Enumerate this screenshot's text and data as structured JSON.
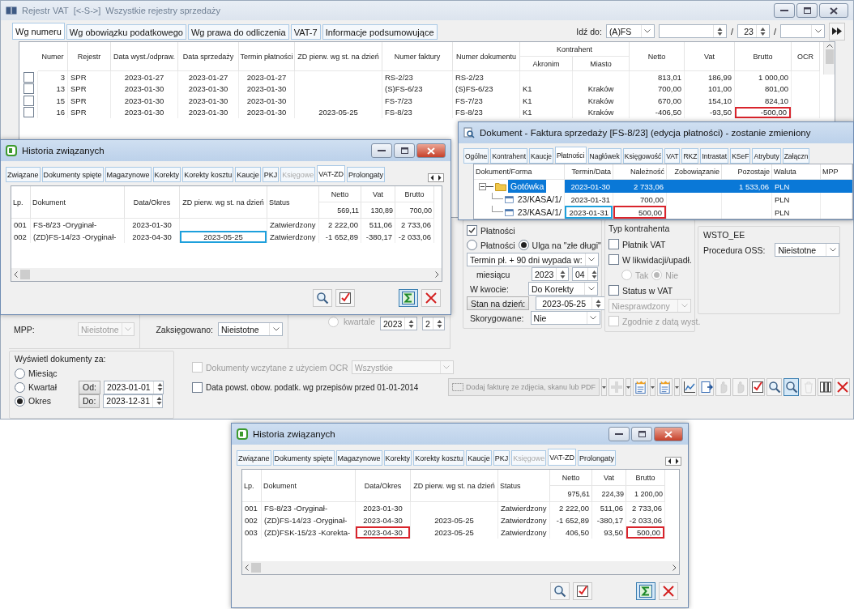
{
  "main_window": {
    "title": "Rejestr VAT",
    "title_tag": "[<-S->]",
    "subtitle": "Wszystkie rejestry sprzedaży",
    "tabs": [
      {
        "label": "Wg numeru",
        "selected": true
      },
      {
        "label": "Wg obowiązku podatkowego",
        "selected": false
      },
      {
        "label": "Wg prawa do odliczenia",
        "selected": false
      },
      {
        "label": "VAT-7",
        "selected": false
      },
      {
        "label": "Informacje podsumowujące",
        "selected": false
      }
    ],
    "goto": {
      "label": "Idź do:",
      "series": "(A)FS",
      "separators": [
        "/",
        "/"
      ],
      "year": "23"
    },
    "table": {
      "columns": [
        "Numer",
        "Rejestr",
        "Data wyst./odpraw.",
        "Data sprzedaży",
        "Termin płatności",
        "ZD pierw. wg st. na dzień",
        "Numer faktury",
        "Numer dokumentu",
        {
          "label": "Akronim",
          "group": "Kontrahent"
        },
        {
          "label": "Miasto",
          "in_group": true
        },
        "Netto",
        "Vat",
        "Brutto",
        "OCR"
      ],
      "rows": [
        {
          "checked": false,
          "cells": [
            "3",
            "SPR",
            "2023-01-27",
            "2023-01-27",
            "2023-01-27",
            null,
            "RS-2/23",
            "RS-2/23",
            null,
            null,
            "813,01",
            "186,99",
            "1 000,00",
            null
          ]
        },
        {
          "checked": false,
          "cells": [
            "13",
            "SPR",
            "2023-01-30",
            "2023-01-30",
            "2023-01-30",
            null,
            "(S)FS-6/23",
            "(S)FS-6/23",
            "K1",
            "Kraków",
            "700,00",
            "101,00",
            "801,00",
            null
          ]
        },
        {
          "checked": false,
          "cells": [
            "15",
            "SPR",
            "2023-01-30",
            "2023-01-30",
            "2023-01-30",
            null,
            "FS-7/23",
            "FS-7/23",
            "K1",
            "Kraków",
            "670,00",
            "154,10",
            "824,10",
            null
          ]
        },
        {
          "checked": false,
          "cells": [
            "16",
            "SPR",
            "2023-01-30",
            "2023-01-30",
            "2023-01-30",
            "2023-05-25",
            "FS-8/23",
            "FS-8/23",
            "K1",
            "Kraków",
            "-406,50",
            "-93,50",
            {
              "text": "-500,00",
              "marked": true
            },
            null
          ]
        }
      ]
    },
    "filters": {
      "mpp": {
        "label": "MPP:",
        "value": "Nieistotne",
        "disabled": true
      },
      "booked": {
        "label": "Zaksięgowano:",
        "value": "Nieistotne",
        "disabled": false
      },
      "quarter": {
        "label": "kwartale",
        "selected": false,
        "year": "2023",
        "quarter": "2"
      }
    },
    "period": {
      "title": "Wyświetl dokumenty za:",
      "options": [
        {
          "label": "Miesiąc",
          "selected": false
        },
        {
          "label": "Kwartał",
          "selected": false
        },
        {
          "label": "Okres",
          "selected": true
        }
      ],
      "from": {
        "label": "Od:",
        "value": "2023-01-01"
      },
      "to": {
        "label": "Do:",
        "value": "2023-12-31"
      }
    },
    "ocr_filter": {
      "label": "Dokumenty wczytane z użyciem OCR",
      "checked": false,
      "disabled": true,
      "value": "Wszystkie"
    },
    "old_rules": {
      "label": "Data powst. obow. podatk. wg przepisów przed 01-01-2014",
      "checked": false
    },
    "payments": {
      "label": "Płatności",
      "checked": true,
      "modes": [
        {
          "label": "Płatności",
          "selected": false
        },
        {
          "label": "Ulga na \"złe długi\"",
          "selected": true
        }
      ],
      "rule": "Termin pł. + 90 dni wypada w:",
      "month_label": "miesiącu",
      "year": "2023",
      "month": "04",
      "amount_label": "W kwocie:",
      "amount": "Do Korekty",
      "state_button": "Stan na dzień:",
      "state_date": "2023-05-25",
      "corrected_label": "Skorygowane:",
      "corrected": "Nie"
    },
    "contractor_type": {
      "title": "Typ kontrahenta",
      "payer": {
        "label": "Płatnik VAT",
        "checked": false
      },
      "liquidation": {
        "label": "W likwidacji/upadł.",
        "checked": false
      },
      "liquidation_options": [
        {
          "label": "Tak",
          "selected": false
        },
        {
          "label": "Nie",
          "selected": true
        }
      ],
      "vat_status": {
        "label": "Status w VAT",
        "checked": false
      },
      "vat_status_value": "Niesprawdzony",
      "match_date": {
        "label": "Zgodnie z datą wyst.",
        "checked": false,
        "disabled": true
      }
    },
    "wsto": {
      "title": "WSTO_EE",
      "label": "Procedura OSS:",
      "value": "Nieistotne"
    },
    "toolbar": {
      "ocr_button": {
        "label": "Dodaj fakturę ze zdjęcia, skanu lub PDF",
        "disabled": true
      },
      "buttons": [
        {
          "kind": "plus",
          "disabled": true,
          "dropdown": true,
          "pressed": false
        },
        {
          "kind": "zd",
          "disabled": false,
          "dropdown": true,
          "pressed": false
        },
        {
          "kind": "vat",
          "disabled": false,
          "dropdown": true,
          "pressed": false
        },
        {
          "kind": "chart",
          "disabled": false,
          "dropdown": false,
          "pressed": false
        },
        {
          "kind": "import",
          "disabled": false,
          "dropdown": false,
          "pressed": false
        },
        {
          "kind": "hand",
          "disabled": true,
          "dropdown": false,
          "pressed": false
        },
        {
          "kind": "hand",
          "disabled": true,
          "dropdown": false,
          "pressed": false
        },
        {
          "kind": "check",
          "disabled": false,
          "dropdown": false,
          "pressed": false
        },
        {
          "kind": "search",
          "disabled": false,
          "dropdown": false,
          "pressed": false
        },
        {
          "kind": "search",
          "disabled": false,
          "dropdown": false,
          "pressed": true
        },
        {
          "kind": "trash",
          "disabled": true,
          "dropdown": false,
          "pressed": false
        },
        {
          "kind": "columns",
          "disabled": false,
          "dropdown": false,
          "pressed": false
        },
        {
          "kind": "close",
          "disabled": false,
          "dropdown": false,
          "pressed": false
        }
      ]
    }
  },
  "history_windows": [
    {
      "title": "Historia związanych",
      "tabs": [
        {
          "label": "Związane",
          "selected": false,
          "disabled": false
        },
        {
          "label": "Dokumenty spięte",
          "selected": false,
          "disabled": false
        },
        {
          "label": "Magazynowe",
          "selected": false,
          "disabled": false
        },
        {
          "label": "Korekty",
          "selected": false,
          "disabled": false
        },
        {
          "label": "Korekty kosztu",
          "selected": false,
          "disabled": false
        },
        {
          "label": "Kaucje",
          "selected": false,
          "disabled": false
        },
        {
          "label": "PKJ",
          "selected": false,
          "disabled": false
        },
        {
          "label": "Księgowe",
          "selected": false,
          "disabled": true
        },
        {
          "label": "VAT-ZD",
          "selected": true,
          "disabled": false
        },
        {
          "label": "Prolongaty",
          "selected": false,
          "disabled": false
        }
      ],
      "columns": [
        "Lp.",
        "Dokument",
        "Data/Okres",
        "ZD pierw. wg st. na dzień",
        "Status",
        {
          "label": "Netto",
          "total": "569,11"
        },
        {
          "label": "Vat",
          "total": "130,89"
        },
        {
          "label": "Brutto",
          "total": "700,00"
        }
      ],
      "rows": [
        [
          "001",
          "FS-8/23 -Oryginał-",
          "2023-01-30",
          null,
          "Zatwierdzony",
          "2 222,00",
          "511,06",
          "2 733,06"
        ],
        [
          "002",
          "(ZD)FS-14/23 -Oryginał-",
          "2023-04-30",
          {
            "text": "2023-05-25",
            "focused": true
          },
          "Zatwierdzony",
          "-1 652,89",
          "-380,17",
          "-2 033,06"
        ]
      ],
      "buttons": [
        {
          "kind": "search",
          "pressed": false
        },
        {
          "kind": "check",
          "pressed": false
        },
        {
          "kind": "sum",
          "pressed": true
        },
        {
          "kind": "close",
          "pressed": false
        }
      ]
    },
    {
      "title": "Historia związanych",
      "tabs": [
        {
          "label": "Związane",
          "selected": false,
          "disabled": false
        },
        {
          "label": "Dokumenty spięte",
          "selected": false,
          "disabled": false
        },
        {
          "label": "Magazynowe",
          "selected": false,
          "disabled": false
        },
        {
          "label": "Korekty",
          "selected": false,
          "disabled": false
        },
        {
          "label": "Korekty kosztu",
          "selected": false,
          "disabled": false
        },
        {
          "label": "Kaucje",
          "selected": false,
          "disabled": false
        },
        {
          "label": "PKJ",
          "selected": false,
          "disabled": false
        },
        {
          "label": "Księgowe",
          "selected": false,
          "disabled": true
        },
        {
          "label": "VAT-ZD",
          "selected": true,
          "disabled": false
        },
        {
          "label": "Prolongaty",
          "selected": false,
          "disabled": false
        }
      ],
      "columns": [
        "Lp.",
        "Dokument",
        "Data/Okres",
        "ZD pierw. wg st. na dzień",
        "Status",
        {
          "label": "Netto",
          "total": "975,61"
        },
        {
          "label": "Vat",
          "total": "224,39"
        },
        {
          "label": "Brutto",
          "total": "1 200,00"
        }
      ],
      "rows": [
        [
          "001",
          "FS-8/23 -Oryginał-",
          "2023-01-30",
          null,
          "Zatwierdzony",
          "2 222,00",
          "511,06",
          "2 733,06"
        ],
        [
          "002",
          "(ZD)FS-14/23 -Oryginał-",
          "2023-04-30",
          "2023-05-25",
          "Zatwierdzony",
          "-1 652,89",
          "-380,17",
          "-2 033,06"
        ],
        [
          "003",
          "(ZD)FSK-15/23 -Korekta-",
          {
            "text": "2023-04-30",
            "marked": true
          },
          "2023-05-25",
          "Zatwierdzony",
          "406,50",
          "93,50",
          {
            "text": "500,00",
            "marked": true
          }
        ]
      ],
      "buttons": [
        {
          "kind": "search",
          "pressed": false
        },
        {
          "kind": "check",
          "pressed": false
        },
        {
          "kind": "sum",
          "pressed": true
        },
        {
          "kind": "close",
          "pressed": false
        }
      ]
    }
  ],
  "document_window": {
    "title": "Dokument - Faktura sprzedaży [FS-8/23] (edycja płatności) - zostanie zmieniony",
    "tabs": [
      {
        "label": "Ogólne",
        "selected": false
      },
      {
        "label": "Kontrahent",
        "selected": false
      },
      {
        "label": "Kaucje",
        "selected": false
      },
      {
        "label": "Płatności",
        "selected": true
      },
      {
        "label": "Nagłówek",
        "selected": false
      },
      {
        "label": "Księgowość",
        "selected": false
      },
      {
        "label": "VAT",
        "selected": false
      },
      {
        "label": "RKZ",
        "selected": false
      },
      {
        "label": "Intrastat",
        "selected": false
      },
      {
        "label": "KSeF",
        "selected": false
      },
      {
        "label": "Atrybuty",
        "selected": false
      },
      {
        "label": "Załączn",
        "selected": false
      }
    ],
    "columns": [
      "Dokument/Forma",
      "Termin/Data",
      "Należność",
      "Zobowiązanie",
      "Pozostaje",
      "Waluta",
      "MPP"
    ],
    "rows": [
      {
        "kind": "folder",
        "selected": true,
        "expanded": true,
        "cells": [
          "Gotówka",
          "2023-01-30",
          "2 733,06",
          null,
          "1 533,06",
          "PLN",
          null
        ],
        "children": [
          {
            "kind": "entry",
            "selected": false,
            "cells": [
              "23/KASA/1/",
              "2023-01-31",
              "700,00",
              null,
              null,
              "PLN",
              null
            ]
          },
          {
            "kind": "entry",
            "selected": false,
            "cells": [
              "23/KASA/1/",
              {
                "text": "2023-01-31",
                "focused": true
              },
              {
                "text": "500,00",
                "marked": true
              },
              null,
              null,
              "PLN",
              null
            ]
          }
        ]
      }
    ]
  }
}
